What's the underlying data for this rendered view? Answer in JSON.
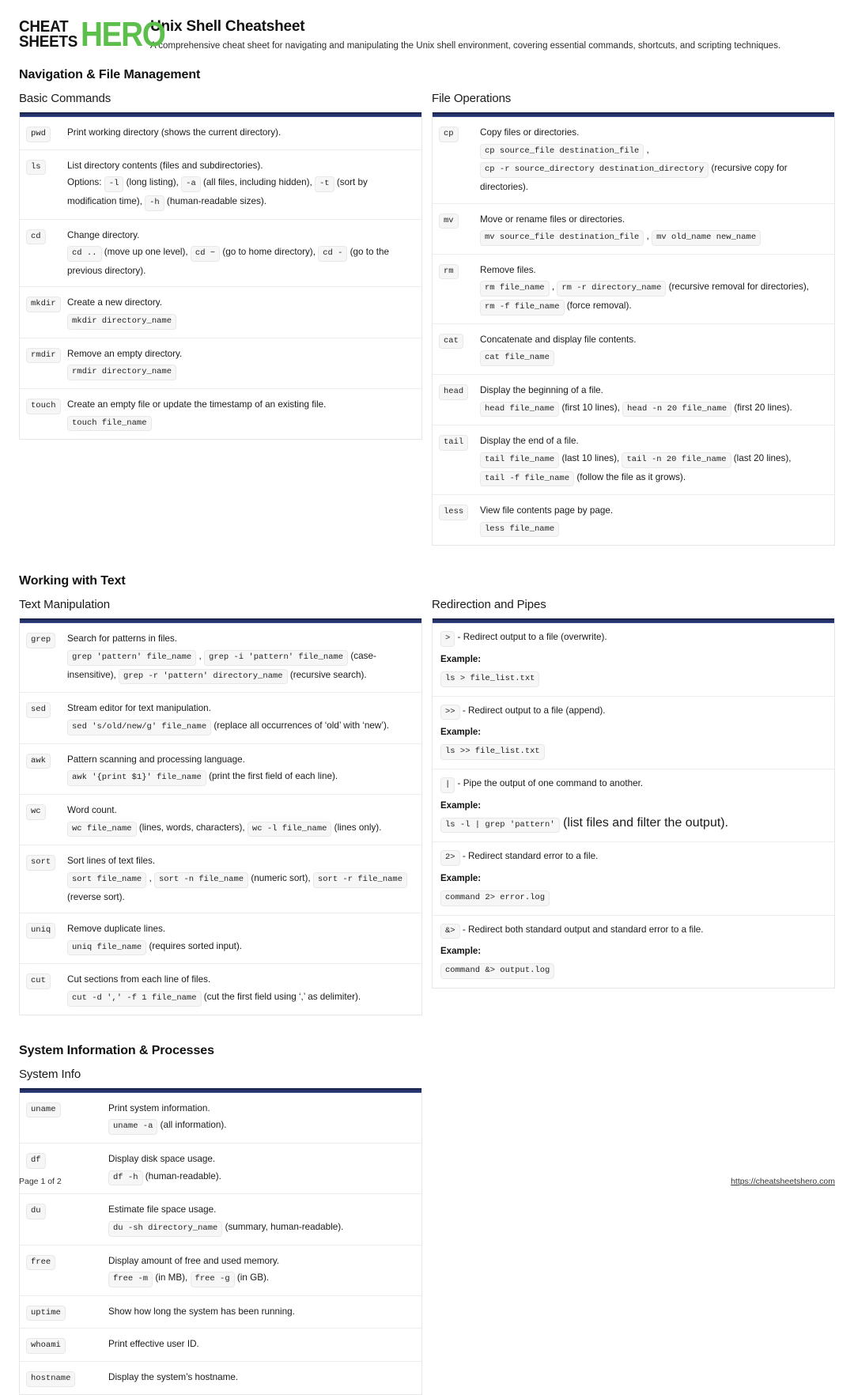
{
  "brand": {
    "logo_line1": "CHEAT",
    "logo_line2": "SHEETS",
    "logo_accent": "HERO",
    "accent_color": "#5cbf4b"
  },
  "header": {
    "title": "Unix Shell Cheatsheet",
    "subtitle": "A comprehensive cheat sheet for navigating and manipulating the Unix shell environment, covering essential commands, shortcuts, and scripting techniques."
  },
  "theme": {
    "bar_color": "#26346b",
    "chip_bg": "#f6f6f6",
    "chip_border": "#e8e8e8",
    "row_divider": "#ededed"
  },
  "sections": [
    {
      "title": "Navigation & File Management",
      "left": {
        "subtitle": "Basic Commands",
        "type": "command-table",
        "rows": [
          {
            "cmd": "pwd",
            "desc": "Print working directory (shows the current directory)."
          },
          {
            "cmd": "ls",
            "desc": "List directory contents (files and subdirectories).",
            "detail_parts": [
              {
                "t": "text",
                "v": "Options: "
              },
              {
                "t": "code",
                "v": "-l"
              },
              {
                "t": "text",
                "v": " (long listing), "
              },
              {
                "t": "code",
                "v": "-a"
              },
              {
                "t": "text",
                "v": " (all files, including hidden), "
              },
              {
                "t": "code",
                "v": "-t"
              },
              {
                "t": "text",
                "v": " (sort by modification time), "
              },
              {
                "t": "code",
                "v": "-h"
              },
              {
                "t": "text",
                "v": " (human-readable sizes)."
              }
            ]
          },
          {
            "cmd": "cd",
            "desc": "Change directory.",
            "detail_parts": [
              {
                "t": "code",
                "v": "cd .."
              },
              {
                "t": "text",
                "v": " (move up one level), "
              },
              {
                "t": "code",
                "v": "cd ~"
              },
              {
                "t": "text",
                "v": " (go to home directory), "
              },
              {
                "t": "code",
                "v": "cd -"
              },
              {
                "t": "text",
                "v": " (go to the previous directory)."
              }
            ]
          },
          {
            "cmd": "mkdir",
            "desc": "Create a new directory.",
            "detail_parts": [
              {
                "t": "code",
                "v": "mkdir directory_name"
              }
            ]
          },
          {
            "cmd": "rmdir",
            "desc": "Remove an empty directory.",
            "detail_parts": [
              {
                "t": "code",
                "v": "rmdir directory_name"
              }
            ]
          },
          {
            "cmd": "touch",
            "desc": "Create an empty file or update the timestamp of an existing file.",
            "detail_parts": [
              {
                "t": "code",
                "v": "touch file_name"
              }
            ]
          }
        ]
      },
      "right": {
        "subtitle": "File Operations",
        "type": "command-table",
        "rows": [
          {
            "cmd": "cp",
            "desc": "Copy files or directories.",
            "detail_parts": [
              {
                "t": "code",
                "v": "cp source_file destination_file"
              },
              {
                "t": "text",
                "v": " , "
              },
              {
                "t": "code",
                "v": "cp -r source_directory destination_directory"
              },
              {
                "t": "text",
                "v": " (recursive copy for directories)."
              }
            ]
          },
          {
            "cmd": "mv",
            "desc": "Move or rename files or directories.",
            "detail_parts": [
              {
                "t": "code",
                "v": "mv source_file destination_file"
              },
              {
                "t": "text",
                "v": " , "
              },
              {
                "t": "code",
                "v": "mv old_name new_name"
              }
            ]
          },
          {
            "cmd": "rm",
            "desc": "Remove files.",
            "detail_parts": [
              {
                "t": "code",
                "v": "rm file_name"
              },
              {
                "t": "text",
                "v": " , "
              },
              {
                "t": "code",
                "v": "rm -r directory_name"
              },
              {
                "t": "text",
                "v": " (recursive removal for directories), "
              },
              {
                "t": "code",
                "v": "rm -f file_name"
              },
              {
                "t": "text",
                "v": " (force removal)."
              }
            ]
          },
          {
            "cmd": "cat",
            "desc": "Concatenate and display file contents.",
            "detail_parts": [
              {
                "t": "code",
                "v": "cat file_name"
              }
            ]
          },
          {
            "cmd": "head",
            "desc": "Display the beginning of a file.",
            "detail_parts": [
              {
                "t": "code",
                "v": "head file_name"
              },
              {
                "t": "text",
                "v": " (first 10 lines), "
              },
              {
                "t": "code",
                "v": "head -n 20 file_name"
              },
              {
                "t": "text",
                "v": " (first 20 lines)."
              }
            ]
          },
          {
            "cmd": "tail",
            "desc": "Display the end of a file.",
            "detail_parts": [
              {
                "t": "code",
                "v": "tail file_name"
              },
              {
                "t": "text",
                "v": " (last 10 lines), "
              },
              {
                "t": "code",
                "v": "tail -n 20 file_name"
              },
              {
                "t": "text",
                "v": " (last 20 lines), "
              },
              {
                "t": "code",
                "v": "tail -f file_name"
              },
              {
                "t": "text",
                "v": " (follow the file as it grows)."
              }
            ]
          },
          {
            "cmd": "less",
            "desc": "View file contents page by page.",
            "detail_parts": [
              {
                "t": "code",
                "v": "less file_name"
              }
            ]
          }
        ]
      }
    },
    {
      "title": "Working with Text",
      "left": {
        "subtitle": "Text Manipulation",
        "type": "command-table",
        "rows": [
          {
            "cmd": "grep",
            "desc": "Search for patterns in files.",
            "detail_parts": [
              {
                "t": "code",
                "v": "grep 'pattern' file_name"
              },
              {
                "t": "text",
                "v": " , "
              },
              {
                "t": "code",
                "v": "grep -i 'pattern' file_name"
              },
              {
                "t": "text",
                "v": " (case-insensitive), "
              },
              {
                "t": "code",
                "v": "grep -r 'pattern' directory_name"
              },
              {
                "t": "text",
                "v": " (recursive search)."
              }
            ]
          },
          {
            "cmd": "sed",
            "desc": "Stream editor for text manipulation.",
            "detail_parts": [
              {
                "t": "code",
                "v": "sed 's/old/new/g' file_name"
              },
              {
                "t": "text",
                "v": " (replace all occurrences of ‘old’ with ‘new’)."
              }
            ]
          },
          {
            "cmd": "awk",
            "desc": "Pattern scanning and processing language.",
            "detail_parts": [
              {
                "t": "code",
                "v": "awk '{print $1}' file_name"
              },
              {
                "t": "text",
                "v": " (print the first field of each line)."
              }
            ]
          },
          {
            "cmd": "wc",
            "desc": "Word count.",
            "detail_parts": [
              {
                "t": "code",
                "v": "wc file_name"
              },
              {
                "t": "text",
                "v": " (lines, words, characters), "
              },
              {
                "t": "code",
                "v": "wc -l file_name"
              },
              {
                "t": "text",
                "v": " (lines only)."
              }
            ]
          },
          {
            "cmd": "sort",
            "desc": "Sort lines of text files.",
            "detail_parts": [
              {
                "t": "code",
                "v": "sort file_name"
              },
              {
                "t": "text",
                "v": " , "
              },
              {
                "t": "code",
                "v": "sort -n file_name"
              },
              {
                "t": "text",
                "v": " (numeric sort), "
              },
              {
                "t": "code",
                "v": "sort -r file_name"
              },
              {
                "t": "text",
                "v": " (reverse sort)."
              }
            ]
          },
          {
            "cmd": "uniq",
            "desc": "Remove duplicate lines.",
            "detail_parts": [
              {
                "t": "code",
                "v": "uniq file_name"
              },
              {
                "t": "text",
                "v": " (requires sorted input)."
              }
            ]
          },
          {
            "cmd": "cut",
            "desc": "Cut sections from each line of files.",
            "detail_parts": [
              {
                "t": "code",
                "v": "cut -d ',' -f 1 file_name"
              },
              {
                "t": "text",
                "v": " (cut the first field using ‘,’ as delimiter)."
              }
            ]
          }
        ]
      },
      "right": {
        "subtitle": "Redirection and Pipes",
        "type": "redirection-table",
        "rows": [
          {
            "operator": ">",
            "desc": "- Redirect output to a file (overwrite).",
            "example_label": "Example:",
            "example": "ls > file_list.txt"
          },
          {
            "operator": ">>",
            "desc": "- Redirect output to a file (append).",
            "example_label": "Example:",
            "example": "ls >> file_list.txt"
          },
          {
            "operator": "|",
            "desc": "- Pipe the output of one command to another.",
            "example_label": "Example:",
            "example": "ls -l | grep 'pattern'",
            "example_note": " (list files and filter the output)."
          },
          {
            "operator": "2>",
            "desc": "- Redirect standard error to a file.",
            "example_label": "Example:",
            "example": "command 2> error.log"
          },
          {
            "operator": "&>",
            "desc": "- Redirect both standard output and standard error to a file.",
            "example_label": "Example:",
            "example": "command &> output.log"
          }
        ]
      }
    },
    {
      "title": "System Information & Processes",
      "left": {
        "subtitle": "System Info",
        "type": "command-table",
        "wide_cmd": true,
        "rows": [
          {
            "cmd": "uname",
            "desc": "Print system information.",
            "detail_parts": [
              {
                "t": "code",
                "v": "uname -a"
              },
              {
                "t": "text",
                "v": " (all information)."
              }
            ]
          },
          {
            "cmd": "df",
            "desc": "Display disk space usage.",
            "detail_parts": [
              {
                "t": "code",
                "v": "df -h"
              },
              {
                "t": "text",
                "v": " (human-readable)."
              }
            ]
          },
          {
            "cmd": "du",
            "desc": "Estimate file space usage.",
            "detail_parts": [
              {
                "t": "code",
                "v": "du -sh directory_name"
              },
              {
                "t": "text",
                "v": " (summary, human-readable)."
              }
            ]
          },
          {
            "cmd": "free",
            "desc": "Display amount of free and used memory.",
            "detail_parts": [
              {
                "t": "code",
                "v": "free -m"
              },
              {
                "t": "text",
                "v": " (in MB), "
              },
              {
                "t": "code",
                "v": "free -g"
              },
              {
                "t": "text",
                "v": " (in GB)."
              }
            ]
          },
          {
            "cmd": "uptime",
            "desc": "Show how long the system has been running."
          },
          {
            "cmd": "whoami",
            "desc": "Print effective user ID."
          },
          {
            "cmd": "hostname",
            "desc": "Display the system’s hostname."
          }
        ]
      },
      "right": null
    }
  ],
  "footer": {
    "page_label": "Page 1 of 2",
    "url": "https://cheatsheetshero.com"
  }
}
